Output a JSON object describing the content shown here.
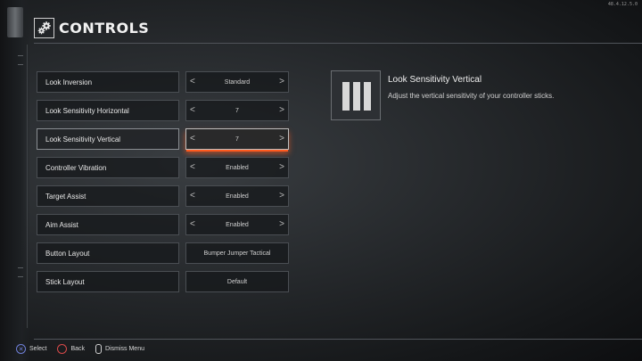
{
  "version": "48.4.12.5.0",
  "header": {
    "title": "CONTROLS",
    "icon": "gears-icon"
  },
  "settings": [
    {
      "label": "Look Inversion",
      "value": "Standard",
      "arrows": true
    },
    {
      "label": "Look Sensitivity Horizontal",
      "value": "7",
      "arrows": true
    },
    {
      "label": "Look Sensitivity Vertical",
      "value": "7",
      "arrows": true,
      "active": true
    },
    {
      "label": "Controller Vibration",
      "value": "Enabled",
      "arrows": true
    },
    {
      "label": "Target Assist",
      "value": "Enabled",
      "arrows": true
    },
    {
      "label": "Aim Assist",
      "value": "Enabled",
      "arrows": true
    },
    {
      "label": "Button Layout",
      "value": "Bumper Jumper Tactical",
      "arrows": false
    },
    {
      "label": "Stick Layout",
      "value": "Default",
      "arrows": false
    }
  ],
  "arrow_left": "<",
  "arrow_right": ">",
  "detail": {
    "title": "Look Sensitivity Vertical",
    "description": "Adjust the vertical sensitivity of your controller sticks."
  },
  "footer": {
    "select": "Select",
    "back": "Back",
    "dismiss": "Dismiss Menu"
  },
  "colors": {
    "accent": "#ff5a1f",
    "cross": "#6f7fd8",
    "circle": "#d84a4a"
  }
}
